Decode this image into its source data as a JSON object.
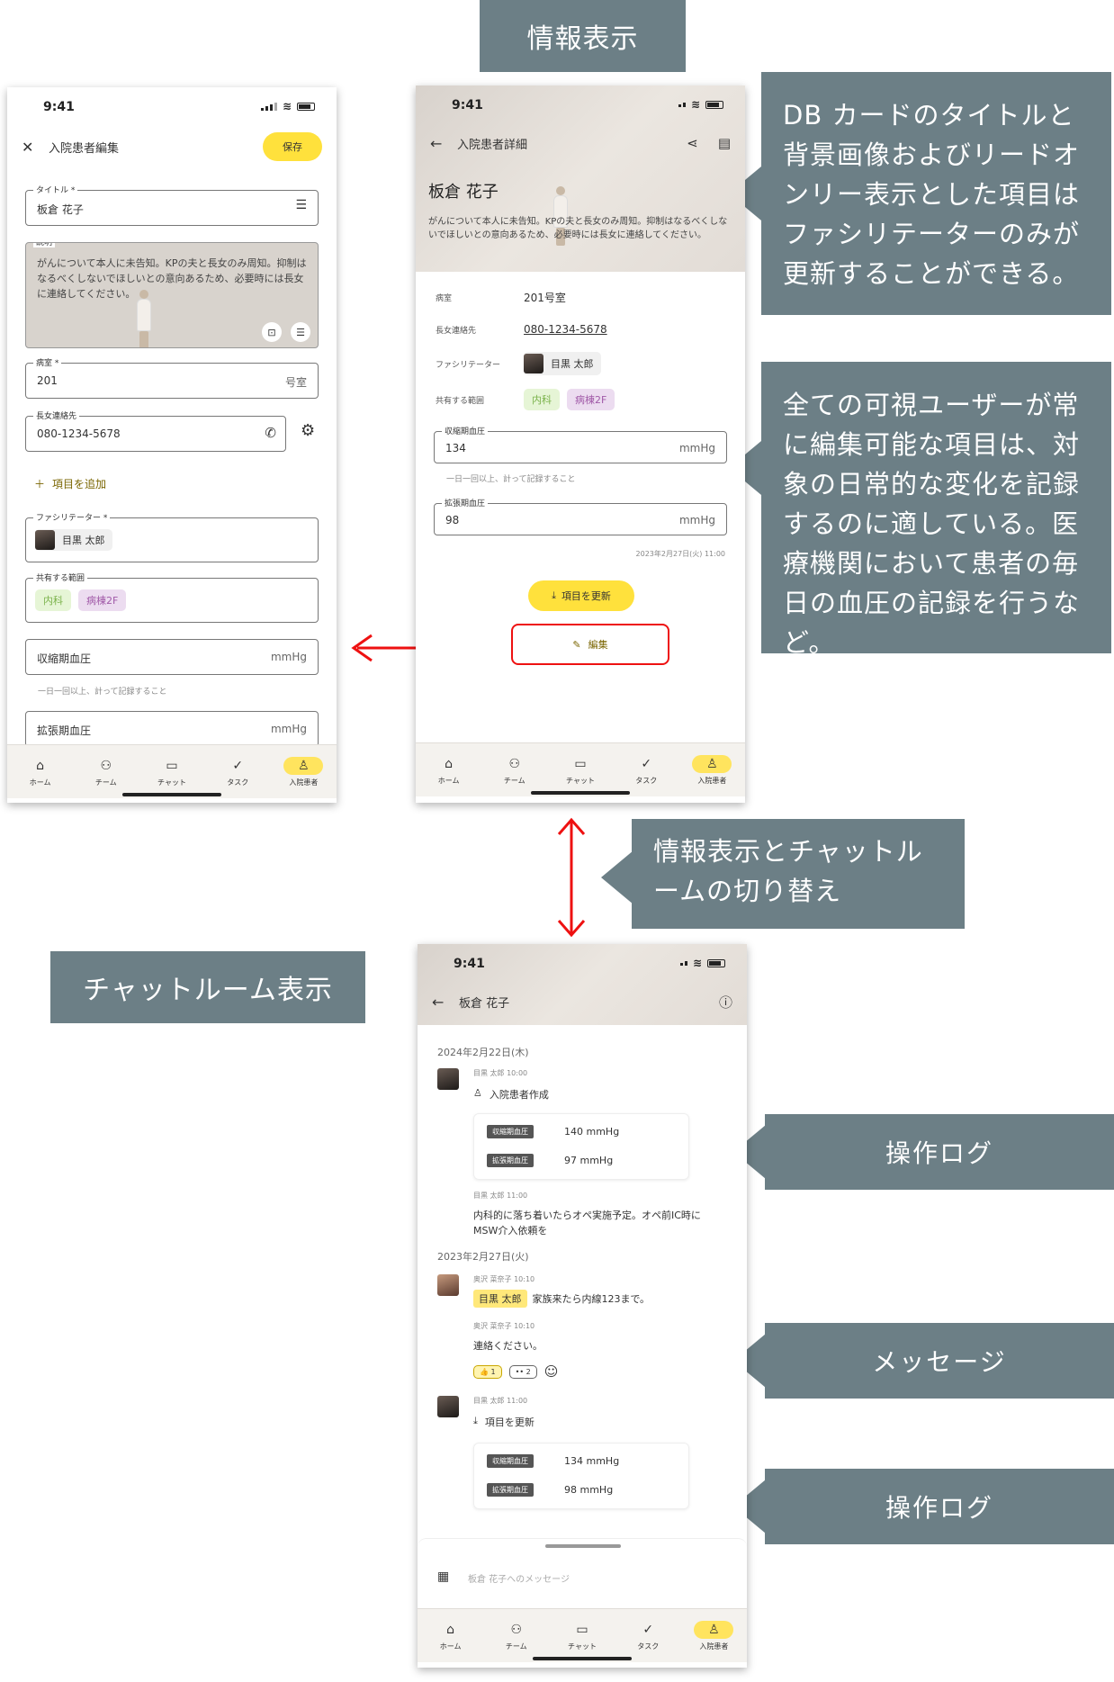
{
  "banners": {
    "info": "情報表示",
    "chat": "チャットルーム表示"
  },
  "notes": {
    "db": "DB カードのタイトルと背景画像およびリードオンリー表示とした項目はファシリテーターのみが更新することができる。",
    "all": "全ての可視ユーザーが常に編集可能な項目は、対象の日常的な変化を記録するのに適している。医療機関において患者の毎日の血圧の記録を行うなど。",
    "switch": "情報表示とチャットルームの切り替え"
  },
  "labels": {
    "oplog1": "操作ログ",
    "message": "メッセージ",
    "oplog2": "操作ログ"
  },
  "status_time": "9:41",
  "nav": [
    "ホーム",
    "チーム",
    "チャット",
    "タスク",
    "入院患者"
  ],
  "edit": {
    "title": "入院患者編集",
    "save": "保存",
    "title_label": "タイトル *",
    "title_value": "板倉 花子",
    "desc_label": "説明",
    "desc_value": "がんについて本人に未告知。KPの夫と長女のみ周知。抑制はなるべくしないでほしいとの意向あるため、必要時には長女に連絡してください。",
    "room_label": "病室 *",
    "room_value": "201",
    "room_unit": "号室",
    "contact_label": "長女連絡先",
    "contact_value": "080-1234-5678",
    "add_item": "項目を追加",
    "facil_label": "ファシリテーター *",
    "facil_name": "目黒 太郎",
    "scope_label": "共有する範囲",
    "scope1": "内科",
    "scope2": "病棟2F",
    "sys_label": "収縮期血圧",
    "unit": "mmHg",
    "sys_hint": "一日一回以上、計って記録すること",
    "dia_label": "拡張期血圧"
  },
  "detail": {
    "title": "入院患者詳細",
    "name": "板倉 花子",
    "desc": "がんについて本人に未告知。KPの夫と長女のみ周知。抑制はなるべくしないでほしいとの意向あるため、必要時には長女に連絡してください。",
    "room_label": "病室",
    "room_value": "201号室",
    "contact_label": "長女連絡先",
    "contact_value": "080-1234-5678",
    "facil_label": "ファシリテーター",
    "facil_name": "目黒 太郎",
    "scope_label": "共有する範囲",
    "scope1": "内科",
    "scope2": "病棟2F",
    "sys_label": "収縮期血圧",
    "sys_value": "134",
    "unit": "mmHg",
    "sys_hint": "一日一回以上、計って記録すること",
    "dia_label": "拡張期血圧",
    "dia_value": "98",
    "timestamp": "2023年2月27日(火) 11:00",
    "update_btn": "項目を更新",
    "edit_btn": "編集"
  },
  "chat": {
    "title": "板倉 花子",
    "date1": "2024年2月22日(木)",
    "m1_meta": "目黒 太郎  10:00",
    "m1_action": "入院患者作成",
    "m1_sys_tag": "収縮期血圧",
    "m1_sys": "140 mmHg",
    "m1_dia_tag": "拡張期血圧",
    "m1_dia": "97 mmHg",
    "m2_meta": "目黒 太郎  11:00",
    "m2_text": "内科的に落ち着いたらオペ実施予定。オペ前IC時にMSW介入依頼を",
    "date2": "2023年2月27日(火)",
    "m3_meta": "奥沢 菜奈子  10:10",
    "m3_mention": "目黒 太郎",
    "m3_text": "家族来たら内線123まで。",
    "m4_meta": "奥沢 菜奈子  10:10",
    "m4_text": "連絡ください。",
    "r1": "1",
    "r2": "2",
    "m5_meta": "目黒 太郎  11:00",
    "m5_action": "項目を更新",
    "m5_sys_tag": "収縮期血圧",
    "m5_sys": "134 mmHg",
    "m5_dia_tag": "拡張期血圧",
    "m5_dia": "98 mmHg",
    "input_placeholder": "板倉 花子へのメッセージ"
  }
}
